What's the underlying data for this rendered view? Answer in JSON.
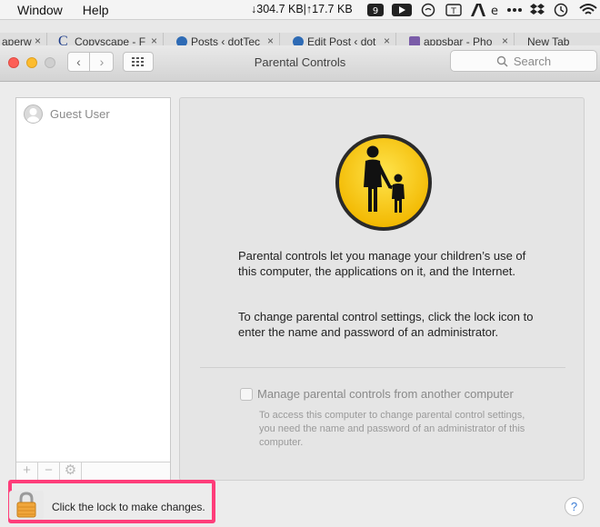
{
  "menubar": {
    "window": "Window",
    "help": "Help",
    "network": "↓304.7 KB|↑17.7 KB",
    "badge": "9",
    "icons": [
      "num-badge-icon",
      "play-icon",
      "chat-icon",
      "ocr-icon",
      "adobe-icon",
      "more-icon",
      "dropbox-icon",
      "time-machine-icon",
      "wifi-icon"
    ]
  },
  "tabs": [
    {
      "label": "aperw",
      "close": "×"
    },
    {
      "label": "Copyscape - F",
      "close": "×"
    },
    {
      "label": "Posts ‹ dotTec",
      "close": "×"
    },
    {
      "label": "Edit Post ‹ dot",
      "close": "×"
    },
    {
      "label": "appsbar - Pho",
      "close": "×"
    },
    {
      "label": "New Tab",
      "close": ""
    }
  ],
  "toolbar": {
    "title": "Parental Controls",
    "back": "‹",
    "forward": "›",
    "search_placeholder": "Search"
  },
  "users": [
    {
      "name": "Guest User"
    }
  ],
  "list_footer": {
    "add": "+",
    "remove": "−",
    "gear": "⚙"
  },
  "panel": {
    "para1": "Parental controls let you manage your children’s use of this computer, the applications on it, and the Internet.",
    "para2": "To change parental control settings, click the lock icon to enter the name and password of an administrator.",
    "checkbox_label": "Manage parental controls from another computer",
    "checkbox_note": "To access this computer to change parental control settings, you need the name and password of an administrator of this computer."
  },
  "lock": {
    "text": "Click the lock to make changes."
  },
  "help": {
    "label": "?"
  },
  "colors": {
    "highlight": "#ff3d7a",
    "icon_yellow": "#f7c600",
    "accent": "#3a7bd5"
  }
}
